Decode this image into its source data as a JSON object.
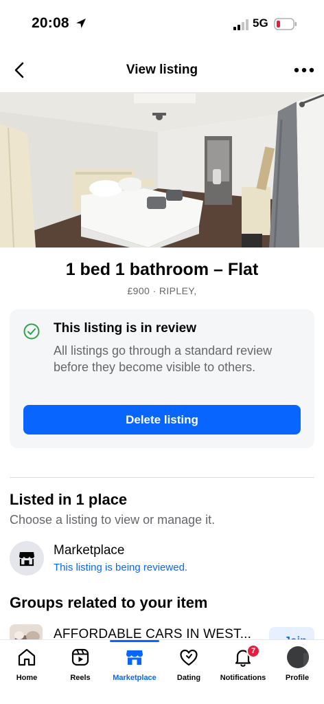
{
  "status_bar": {
    "time": "20:08",
    "network": "5G",
    "icons": [
      "location-arrow-icon",
      "signal-icon",
      "battery-low-icon"
    ]
  },
  "header": {
    "title": "View listing",
    "back_icon": "chevron-left-icon",
    "more_icon": "more-dots-icon"
  },
  "listing": {
    "title": "1 bed 1 bathroom – Flat",
    "meta": "£900 · RIPLEY,"
  },
  "review": {
    "icon": "check-circle-icon",
    "title": "This listing is in review",
    "description": "All listings go through a standard review before they become visible to others.",
    "delete_label": "Delete listing"
  },
  "listed": {
    "heading": "Listed in 1 place",
    "subheading": "Choose a listing to view or manage it.",
    "items": [
      {
        "icon": "marketplace-icon",
        "name": "Marketplace",
        "status": "This listing is being reviewed."
      }
    ]
  },
  "groups": {
    "heading": "Groups related to your item",
    "items": [
      {
        "name": "AFFORDABLE  CARS IN WEST...",
        "button_label": "Join"
      }
    ]
  },
  "tab_bar": {
    "tabs": [
      {
        "label": "Home",
        "icon": "home-icon",
        "active": false
      },
      {
        "label": "Reels",
        "icon": "reels-icon",
        "active": false
      },
      {
        "label": "Marketplace",
        "icon": "marketplace-icon",
        "active": true
      },
      {
        "label": "Dating",
        "icon": "dating-heart-icon",
        "active": false
      },
      {
        "label": "Notifications",
        "icon": "bell-icon",
        "active": false,
        "badge": "7"
      },
      {
        "label": "Profile",
        "icon": "profile-avatar",
        "active": false
      }
    ]
  },
  "colors": {
    "accent": "#0866ff",
    "success": "#31a24c",
    "badge": "#e41e3f",
    "card_background": "#f5f6f7"
  }
}
